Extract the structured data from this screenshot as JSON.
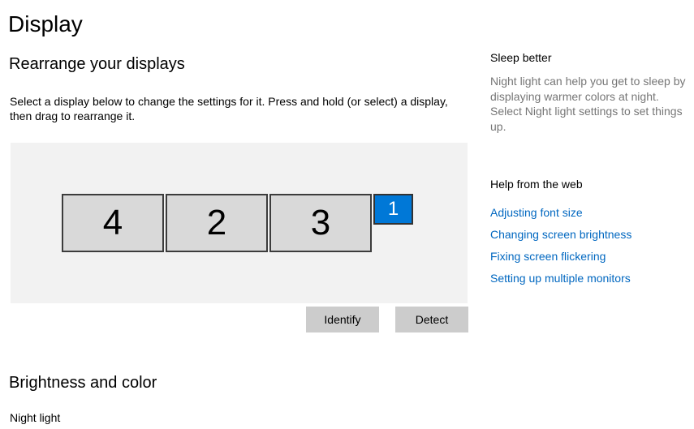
{
  "page": {
    "title": "Display"
  },
  "rearrange": {
    "heading": "Rearrange your displays",
    "description": "Select a display below to change the settings for it. Press and hold (or select) a display, then drag to rearrange it.",
    "displays": [
      "4",
      "2",
      "3",
      "1"
    ],
    "selected_display": "1",
    "identify_label": "Identify",
    "detect_label": "Detect"
  },
  "brightness": {
    "heading": "Brightness and color",
    "night_light_label": "Night light"
  },
  "sidebar": {
    "sleep_heading": "Sleep better",
    "sleep_text": "Night light can help you get to sleep by displaying warmer colors at night. Select Night light settings to set things up.",
    "help_heading": "Help from the web",
    "links": [
      "Adjusting font size",
      "Changing screen brightness",
      "Fixing screen flickering",
      "Setting up multiple monitors"
    ]
  },
  "colors": {
    "accent": "#0078d7",
    "link": "#0067c0",
    "secondary_text": "#767676",
    "panel_bg": "#f2f2f2",
    "button_bg": "#cccccc"
  }
}
